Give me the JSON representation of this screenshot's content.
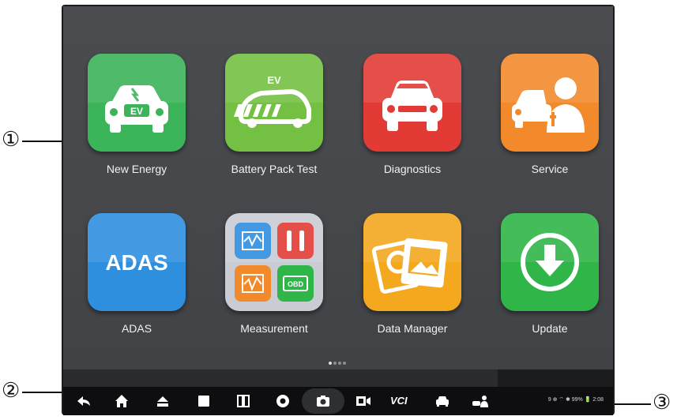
{
  "callouts": {
    "one": "①",
    "two": "②",
    "three": "③"
  },
  "apps": [
    {
      "label": "New Energy",
      "color": "#3bb45a",
      "icon": "ev-car-icon",
      "badge": "EV"
    },
    {
      "label": "Battery Pack Test",
      "color": "#74c043",
      "icon": "battery-pack-icon",
      "badge": "EV"
    },
    {
      "label": "Diagnostics",
      "color": "#e23b35",
      "icon": "car-front-icon"
    },
    {
      "label": "Service",
      "color": "#f28a2c",
      "icon": "service-technician-icon"
    },
    {
      "label": "ADAS",
      "color": "#2e8fdf",
      "icon": "adas-text-icon",
      "badge": "ADAS"
    },
    {
      "label": "Measurement",
      "color": "#c9ccd3",
      "icon": "measurement-grid-icon",
      "badge": "OBD"
    },
    {
      "label": "Data Manager",
      "color": "#f3a81e",
      "icon": "photos-icon"
    },
    {
      "label": "Update",
      "color": "#2fb548",
      "icon": "download-arrow-icon"
    }
  ],
  "navbar": {
    "icons": [
      "back-icon",
      "home-icon",
      "eject-home-icon",
      "recent-apps-icon",
      "split-screen-icon",
      "chrome-browser-icon",
      "camera-icon",
      "screen-record-icon",
      "vci-icon",
      "car-icon",
      "technician-icon"
    ],
    "vci_label": "VCI",
    "status_text": "9 ⊕ ⌔  ✱ 99% 🔋 2:08"
  }
}
